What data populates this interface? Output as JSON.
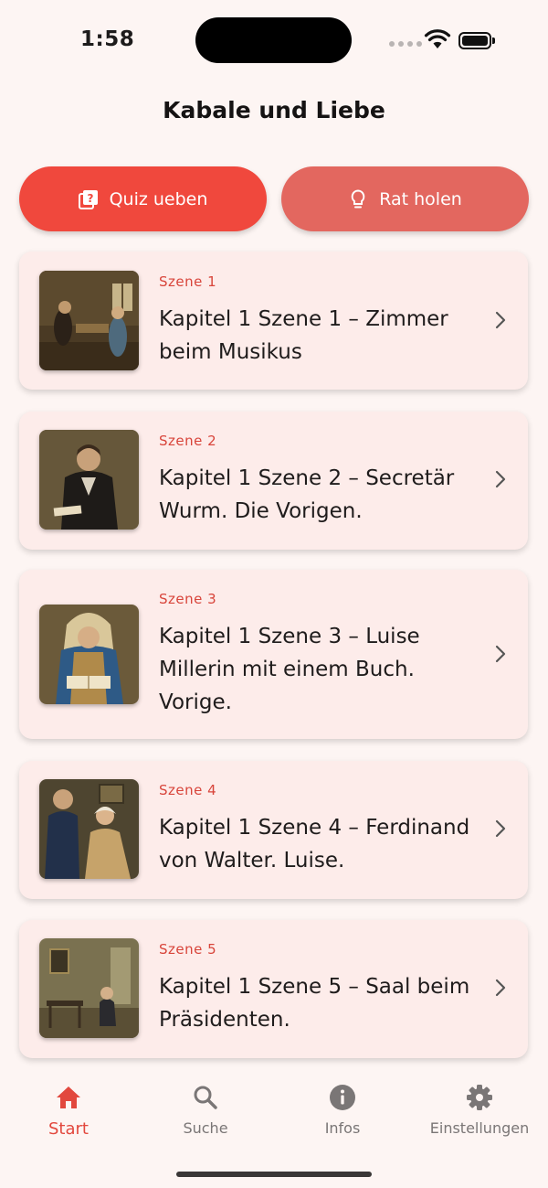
{
  "status_bar": {
    "time": "1:58"
  },
  "header": {
    "title": "Kabale und Liebe"
  },
  "actions": [
    {
      "label": "Quiz ueben",
      "icon": "quiz-icon"
    },
    {
      "label": "Rat holen",
      "icon": "lightbulb-icon"
    }
  ],
  "scenes": [
    {
      "label": "Szene 1",
      "title": "Kapitel 1 Szene 1 – Zimmer beim Musikus",
      "thumbnail": "painting-room-with-two-figures"
    },
    {
      "label": "Szene 2",
      "title": "Kapitel 1 Szene 2 – Secretär Wurm. Die Vorigen.",
      "thumbnail": "painting-man-holding-papers"
    },
    {
      "label": "Szene 3",
      "title": "Kapitel 1 Szene 3 – Luise Millerin mit einem Buch. Vorige.",
      "thumbnail": "painting-woman-reading-book"
    },
    {
      "label": "Szene 4",
      "title": "Kapitel 1 Szene 4 – Ferdinand von Walter. Luise.",
      "thumbnail": "painting-couple-in-room"
    },
    {
      "label": "Szene 5",
      "title": "Kapitel 1 Szene 5 – Saal beim Präsidenten.",
      "thumbnail": "painting-hall-with-seated-man"
    }
  ],
  "bottom_nav": [
    {
      "label": "Start",
      "icon": "home-icon",
      "active": true
    },
    {
      "label": "Suche",
      "icon": "search-icon",
      "active": false
    },
    {
      "label": "Infos",
      "icon": "info-icon",
      "active": false
    },
    {
      "label": "Einstellungen",
      "icon": "gear-icon",
      "active": false
    }
  ],
  "colors": {
    "background": "#fdf5f3",
    "card": "#fdecea",
    "primary": "#f0483d",
    "secondary": "#e3675f",
    "accent_text": "#d8453b",
    "nav_inactive": "#7a7676"
  }
}
